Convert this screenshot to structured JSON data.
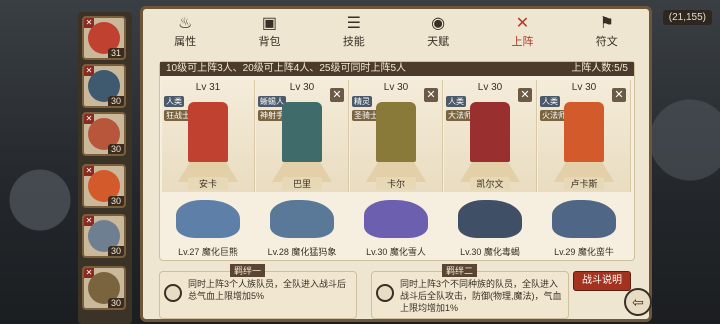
{
  "hud": {
    "gold": "(21,155)"
  },
  "tabs": [
    {
      "label": "属性",
      "icon": "fire-icon"
    },
    {
      "label": "背包",
      "icon": "bag-icon"
    },
    {
      "label": "技能",
      "icon": "book-icon"
    },
    {
      "label": "天赋",
      "icon": "eye-icon"
    },
    {
      "label": "上阵",
      "icon": "crossed-swords-icon",
      "active": true
    },
    {
      "label": "符文",
      "icon": "rune-icon"
    }
  ],
  "info": {
    "left": "10级可上阵3人、20级可上阵4人、25级可同时上阵5人",
    "right": "上阵人数:5/5"
  },
  "roster": [
    {
      "lv": "31",
      "color": "#c0412f"
    },
    {
      "lv": "30",
      "color": "#3f5a6e"
    },
    {
      "lv": "30",
      "color": "#b7563a"
    },
    {
      "lv": "30",
      "color": "#d35a2a"
    },
    {
      "lv": "30",
      "color": "#6d7f90"
    },
    {
      "lv": "30",
      "color": "#7a6440"
    }
  ],
  "team": [
    {
      "lv": "Lv 31",
      "tag1": "人类",
      "tag2": "狂战士",
      "name": "安卡",
      "color": "#c0412f",
      "close": false
    },
    {
      "lv": "Lv 30",
      "tag1": "蜥蜴人",
      "tag2": "神射手",
      "name": "巴里",
      "color": "#3f6b6a",
      "close": true
    },
    {
      "lv": "Lv 30",
      "tag1": "精灵",
      "tag2": "圣骑士",
      "name": "卡尔",
      "color": "#8a7a3a",
      "close": true
    },
    {
      "lv": "Lv 30",
      "tag1": "人类",
      "tag2": "大法师",
      "name": "凯尔文",
      "color": "#9a2f2f",
      "close": true
    },
    {
      "lv": "Lv 30",
      "tag1": "人类",
      "tag2": "火法师",
      "name": "卢卡斯",
      "color": "#d35a2a",
      "close": true
    }
  ],
  "pets": [
    {
      "label": "Lv.27 魔化巨熊",
      "color": "#5e7fa8"
    },
    {
      "label": "Lv.28 魔化猛犸象",
      "color": "#5a7898"
    },
    {
      "label": "Lv.30 魔化雪人",
      "color": "#6d5fb0"
    },
    {
      "label": "Lv.30 魔化毒蝎",
      "color": "#3f4f66"
    },
    {
      "label": "Lv.29 魔化蛮牛",
      "color": "#506686"
    }
  ],
  "bonds": [
    {
      "title": "羁绊一",
      "text": "同时上阵3个人族队员，全队进入战斗后总气血上限增加5%"
    },
    {
      "title": "羁绊二",
      "text": "同时上阵3个不同种族的队员，全队进入战斗后全队攻击，防御(物理,魔法)，气血上限均增加1%"
    }
  ],
  "buttons": {
    "fight_info": "战斗说明",
    "back": "⇦"
  }
}
